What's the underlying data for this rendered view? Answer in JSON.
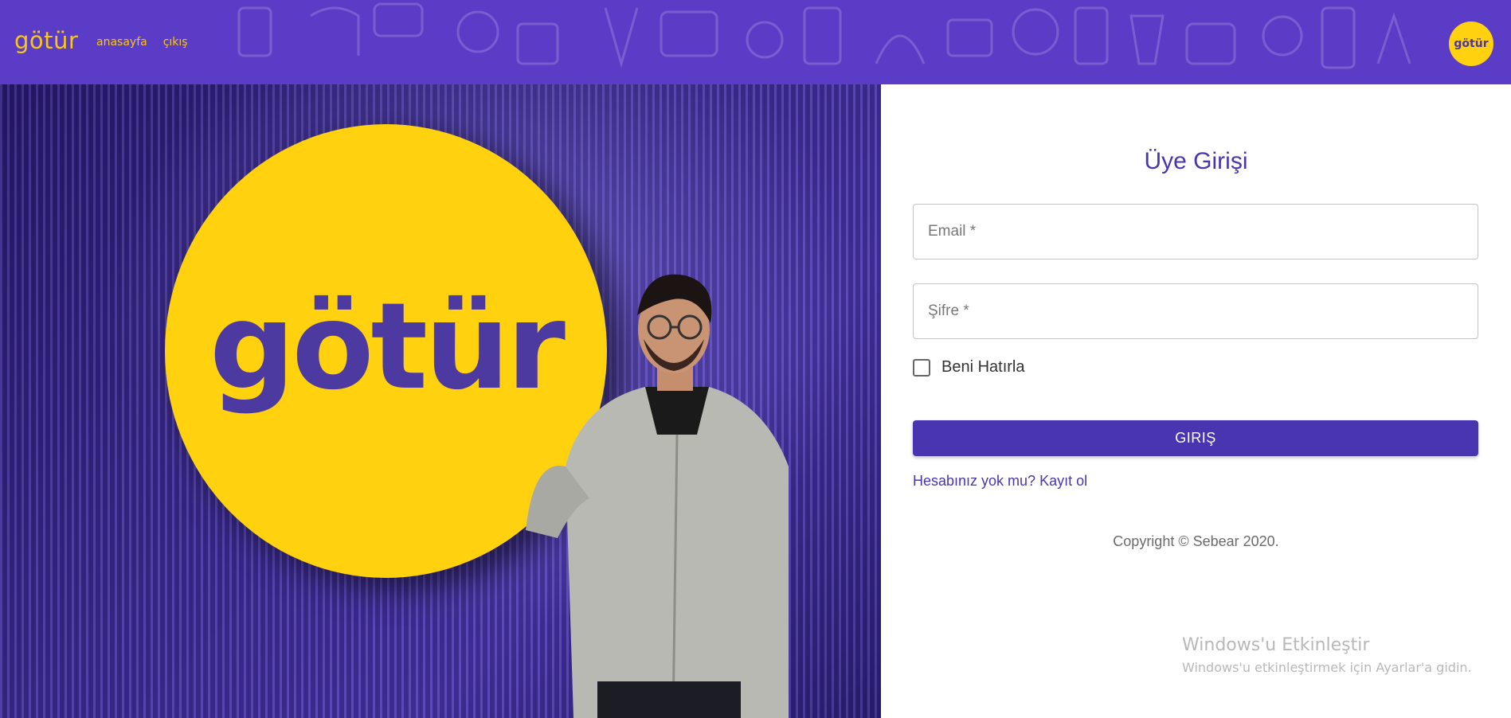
{
  "topbar": {
    "brand": "götür",
    "nav": [
      {
        "label": "anasayfa"
      },
      {
        "label": "çıkış"
      }
    ],
    "avatar_text": "götür"
  },
  "hero": {
    "logo_text": "götür"
  },
  "login": {
    "title": "Üye Girişi",
    "email_placeholder": "Email *",
    "password_placeholder": "Şifre *",
    "remember_label": "Beni Hatırla",
    "submit_label": "GIRIŞ",
    "signup_link": "Hesabınız yok mu? Kayıt ol",
    "copyright": "Copyright © Sebear 2020."
  },
  "watermark": {
    "title": "Windows'u Etkinleştir",
    "subtitle": "Windows'u etkinleştirmek için Ayarlar'a gidin."
  },
  "colors": {
    "brand_purple": "#5a3cc6",
    "brand_yellow": "#ffd10f",
    "button_purple": "#4a35b0"
  }
}
